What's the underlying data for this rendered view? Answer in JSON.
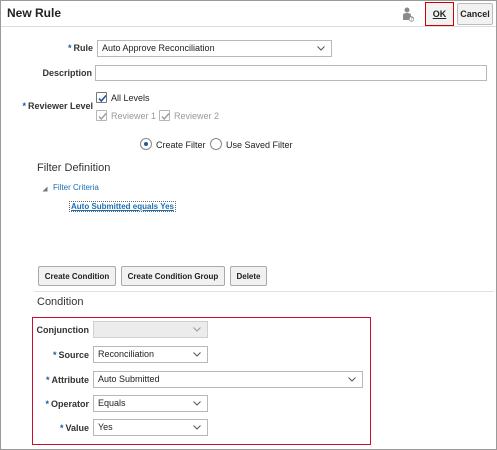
{
  "dialog": {
    "title": "New Rule",
    "ok_label": "OK",
    "cancel_label": "Cancel"
  },
  "form": {
    "rule": {
      "label": "Rule",
      "value": "Auto Approve Reconciliation"
    },
    "description": {
      "label": "Description",
      "value": ""
    },
    "reviewer_level": {
      "label": "Reviewer Level",
      "all_levels": {
        "label": "All Levels",
        "checked": true
      },
      "reviewer1": {
        "label": "Reviewer 1",
        "checked": true,
        "disabled": true
      },
      "reviewer2": {
        "label": "Reviewer 2",
        "checked": true,
        "disabled": true
      }
    },
    "filter_mode": {
      "create_filter": {
        "label": "Create Filter",
        "selected": true
      },
      "use_saved_filter": {
        "label": "Use Saved Filter",
        "selected": false
      }
    }
  },
  "filter_definition": {
    "title": "Filter Definition",
    "criteria_node": "Filter Criteria",
    "condition_item": "Auto Submitted equals Yes"
  },
  "toolbar": {
    "create_condition": "Create Condition",
    "create_condition_group": "Create Condition Group",
    "delete": "Delete"
  },
  "condition": {
    "title": "Condition",
    "conjunction": {
      "label": "Conjunction",
      "value": ""
    },
    "source": {
      "label": "Source",
      "value": "Reconciliation"
    },
    "attribute": {
      "label": "Attribute",
      "value": "Auto Submitted"
    },
    "operator": {
      "label": "Operator",
      "value": "Equals"
    },
    "value": {
      "label": "Value",
      "value": "Yes"
    }
  },
  "colors": {
    "accent": "#1a5aa3",
    "highlight_border": "#c8102e",
    "link": "#1a6fb5"
  }
}
